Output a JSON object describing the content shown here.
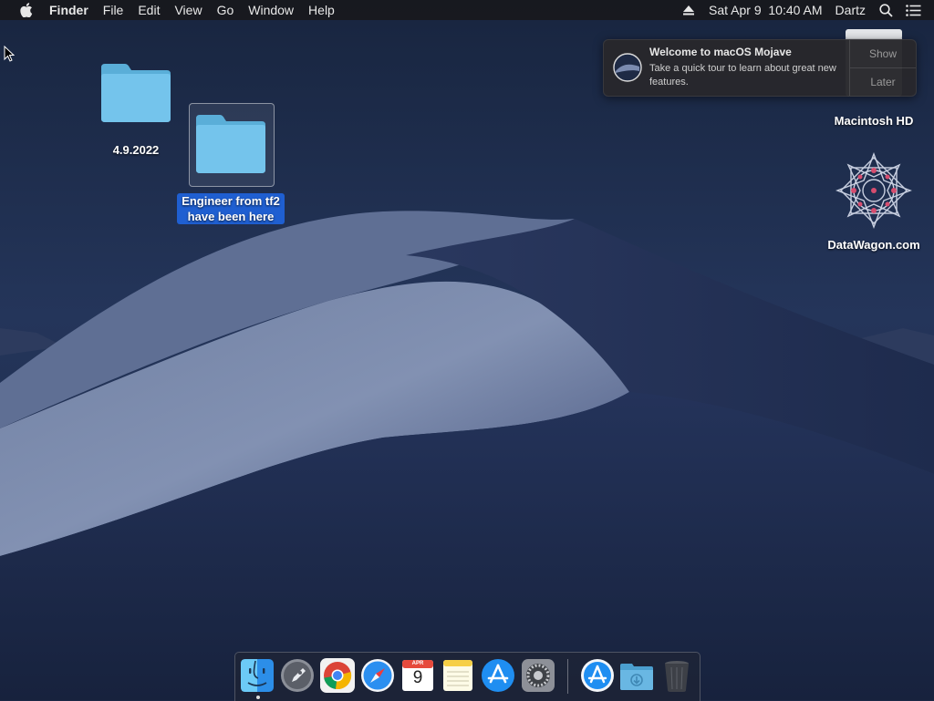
{
  "menubar": {
    "app_name": "Finder",
    "menus": [
      "File",
      "Edit",
      "View",
      "Go",
      "Window",
      "Help"
    ],
    "datetime": "Sat Apr 9  10:40 AM",
    "user": "Dartz",
    "icons": [
      "apple-icon",
      "eject-icon",
      "spotlight-search-icon",
      "notification-center-icon"
    ]
  },
  "desktop": {
    "items": [
      {
        "label": "4.9.2022",
        "icon": "folder-icon",
        "selected": false
      },
      {
        "label": "Engineer from tf2 have been here",
        "icon": "folder-icon",
        "selected": true
      },
      {
        "label": "Macintosh HD",
        "icon": "hard-drive-icon",
        "selected": false
      },
      {
        "label": "DataWagon.com",
        "icon": "geometric-star-icon",
        "selected": false
      }
    ]
  },
  "notification": {
    "title": "Welcome to macOS Mojave",
    "body": "Take a quick tour to learn about great new features.",
    "actions": [
      "Show",
      "Later"
    ]
  },
  "dock": {
    "apps": [
      "finder-icon",
      "launchpad-icon",
      "chrome-icon",
      "safari-icon",
      "calendar-icon",
      "notes-icon",
      "app-store-icon",
      "system-preferences-icon"
    ],
    "calendar_month": "APR",
    "calendar_day": "9",
    "extras": [
      "app-store-download-icon",
      "downloads-folder-icon",
      "trash-icon"
    ]
  },
  "colors": {
    "accent": "#1f5fd1",
    "menubar": "#18181c",
    "sky_top": "#1d2c4c",
    "folder": "#6fc0ea"
  }
}
